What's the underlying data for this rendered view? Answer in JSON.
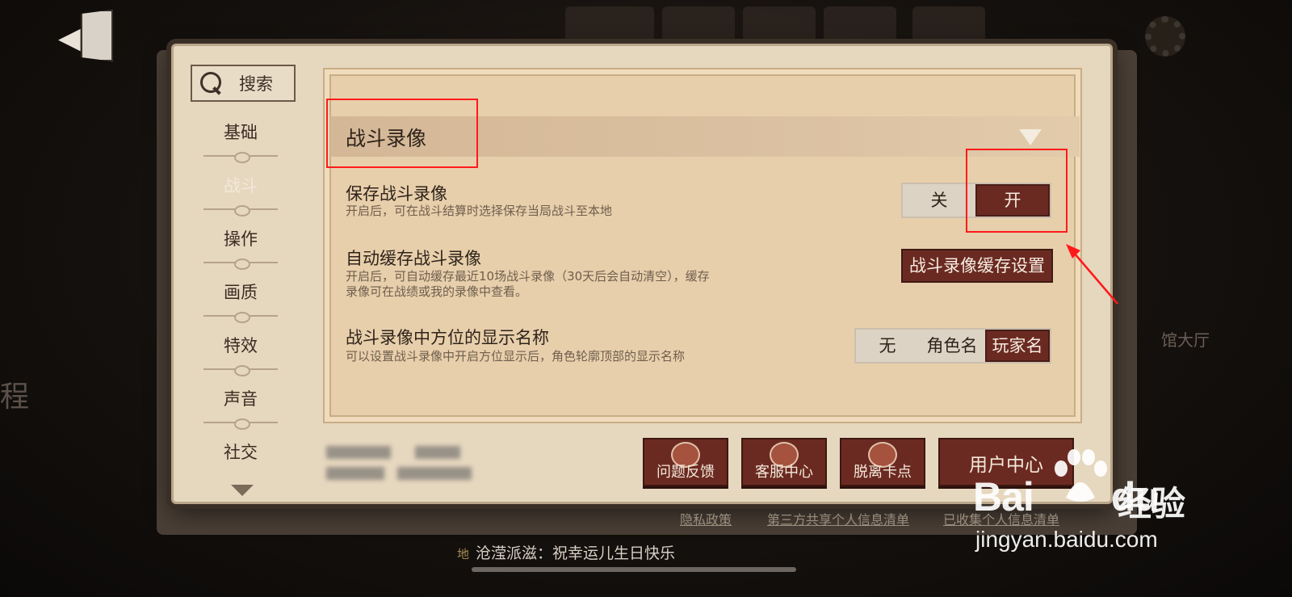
{
  "sidebar": {
    "search_label": "搜索",
    "items": [
      {
        "label": "基础"
      },
      {
        "label": "战斗"
      },
      {
        "label": "操作"
      },
      {
        "label": "画质"
      },
      {
        "label": "特效"
      },
      {
        "label": "声音"
      },
      {
        "label": "社交"
      }
    ],
    "active_index": 1
  },
  "section": {
    "title": "战斗录像"
  },
  "settings": [
    {
      "title": "保存战斗录像",
      "desc": "开启后，可在战斗结算时选择保存当局战斗至本地",
      "options": [
        "关",
        "开"
      ],
      "selected": "开"
    },
    {
      "title": "自动缓存战斗录像",
      "desc_line1": "开启后，可自动缓存最近10场战斗录像（30天后会自动清空），缓存",
      "desc_line2": "录像可在战绩或我的录像中查看。",
      "button_label": "战斗录像缓存设置"
    },
    {
      "title": "战斗录像中方位的显示名称",
      "desc": "可以设置战斗录像中开启方位显示后，角色轮廓顶部的显示名称",
      "options": [
        "无",
        "角色名",
        "玩家名"
      ],
      "selected": "玩家名"
    }
  ],
  "bottom_buttons": [
    {
      "label": "问题反馈",
      "icon": "pen-icon"
    },
    {
      "label": "客服中心",
      "icon": "service-agent-icon"
    },
    {
      "label": "脱离卡点",
      "icon": "escape-arrow-icon"
    },
    {
      "label": "用户中心",
      "icon": ""
    }
  ],
  "footer_links": [
    "隐私政策",
    "第三方共享个人信息清单",
    "已收集个人信息清单"
  ],
  "chat": {
    "channel": "地",
    "message": "沧滢派滋：祝幸运儿生日快乐"
  },
  "background": {
    "left_text": "程",
    "right_text": "馆大厅"
  },
  "watermark": {
    "brand_latin": "Bai",
    "brand_latin2": "du",
    "brand_cn": "经验",
    "url": "jingyan.baidu.com"
  },
  "colors": {
    "accent": "#6a2a22",
    "highlight_box": "#ff1a1a",
    "parchment": "#e8cfab"
  }
}
